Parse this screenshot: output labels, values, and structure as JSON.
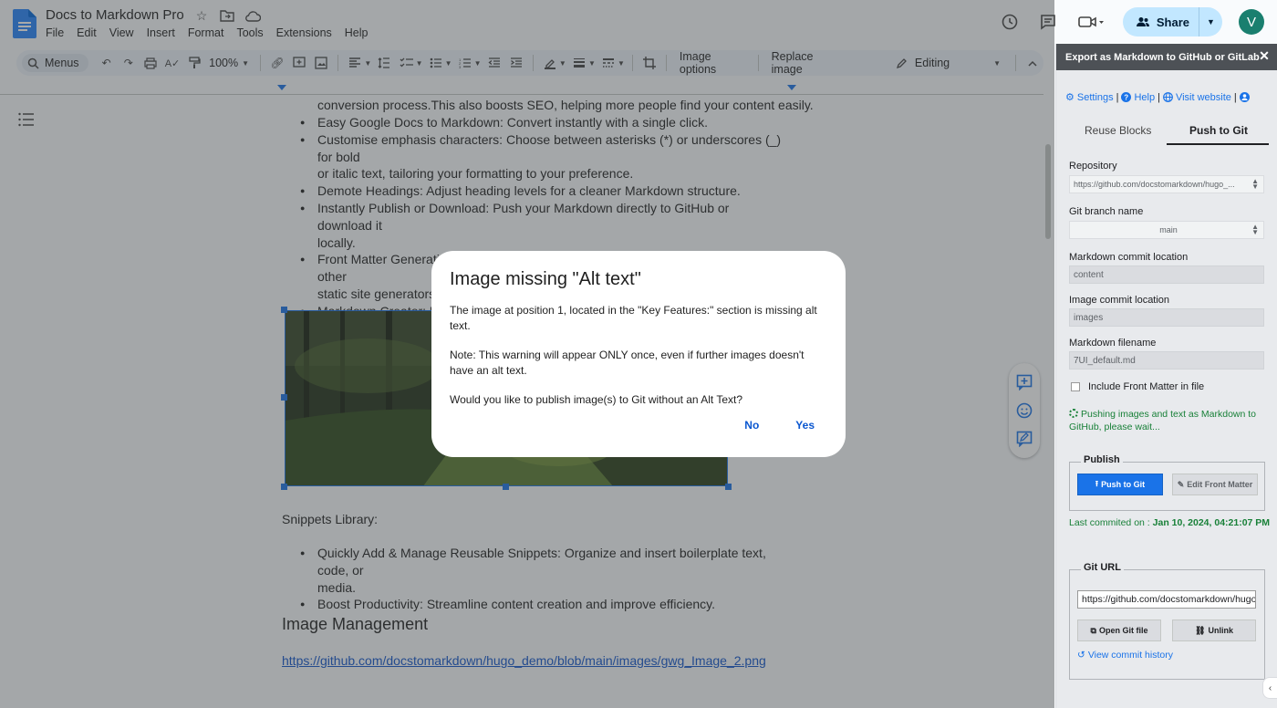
{
  "app": {
    "title": "Docs to Markdown Pro",
    "menu": [
      "File",
      "Edit",
      "View",
      "Insert",
      "Format",
      "Tools",
      "Extensions",
      "Help"
    ],
    "share_label": "Share",
    "avatar_letter": "V"
  },
  "toolbar": {
    "search_label": "Menus",
    "zoom": "100%",
    "image_options": "Image options",
    "replace_image": "Replace image",
    "mode": "Editing"
  },
  "document": {
    "line_top": "conversion process.This also boosts SEO, helping more people find your content easily.",
    "bullets": [
      {
        "lines": [
          "Easy Google Docs to Markdown: Convert instantly with a single click."
        ]
      },
      {
        "html_key": "emphasis",
        "lines": [
          "Customise emphasis characters: Choose between asterisks (*) or underscores (_) for bold",
          "or italic text, tailoring your formatting to your preference."
        ]
      },
      {
        "lines": [
          "Demote Headings: Adjust heading levels for a cleaner Markdown structure."
        ]
      },
      {
        "lines": [
          "Instantly Publish or Download: Push your Markdown directly to GitHub or download it",
          "locally."
        ]
      },
      {
        "lines": [
          "Front Matter Generation: Automatically generate metadata for Hugo, Jekyll, and other",
          "static site generators."
        ]
      },
      {
        "lines": [
          "Markdown Creator: Us"
        ]
      }
    ],
    "snippets_title": "Snippets Library:",
    "snippet_bullets": [
      {
        "lines": [
          "Quickly Add & Manage Reusable Snippets: Organize and insert boilerplate text, code, or",
          "media."
        ]
      },
      {
        "lines": [
          "Boost Productivity: Streamline content creation and improve efficiency."
        ]
      }
    ],
    "heading": "Image Management",
    "link": "https://github.com/docstomarkdown/hugo_demo/blob/main/images/gwg_Image_2.png"
  },
  "dialog": {
    "title": "Image missing \"Alt text\"",
    "p1": "The image at position 1, located in the \"Key Features:\" section is missing alt text.",
    "p2": "Note: This warning will appear ONLY once, even if further images doesn't have an alt text.",
    "p3": "Would you like to publish image(s) to Git without an Alt Text?",
    "no": "No",
    "yes": "Yes"
  },
  "sidebar": {
    "header": "Export as Markdown to GitHub or GitLab",
    "links": {
      "settings": "Settings",
      "help": "Help",
      "website": "Visit website",
      "sep": "|"
    },
    "tabs": [
      "Reuse Blocks",
      "Push to Git"
    ],
    "repository_label": "Repository",
    "repository_value": "https://github.com/docstomarkdown/hugo_...",
    "branch_label": "Git branch name",
    "branch_value": "main",
    "md_location_label": "Markdown commit location",
    "md_location_value": "content",
    "img_location_label": "Image commit location",
    "img_location_value": "images",
    "filename_label": "Markdown filename",
    "filename_value": "7UI_default.md",
    "front_matter_label": "Include Front Matter in file",
    "status": "Pushing images and text as Markdown to GitHub, please wait...",
    "publish_legend": "Publish",
    "push_button": "Push to Git",
    "edit_front_matter": "Edit Front Matter",
    "last_commit_label": "Last commited on :",
    "last_commit_value": "Jan 10, 2024, 04:21:07 PM",
    "git_url_legend": "Git URL",
    "git_url_value": "https://github.com/docstomarkdown/hugo_demo",
    "open_git_file": "Open Git file",
    "unlink": "Unlink",
    "history": "View commit history"
  },
  "colors": {
    "accent": "#1a73e8",
    "share_bg": "#c2e7ff",
    "status_green": "#188038",
    "sidebar_header": "#4d5156"
  }
}
